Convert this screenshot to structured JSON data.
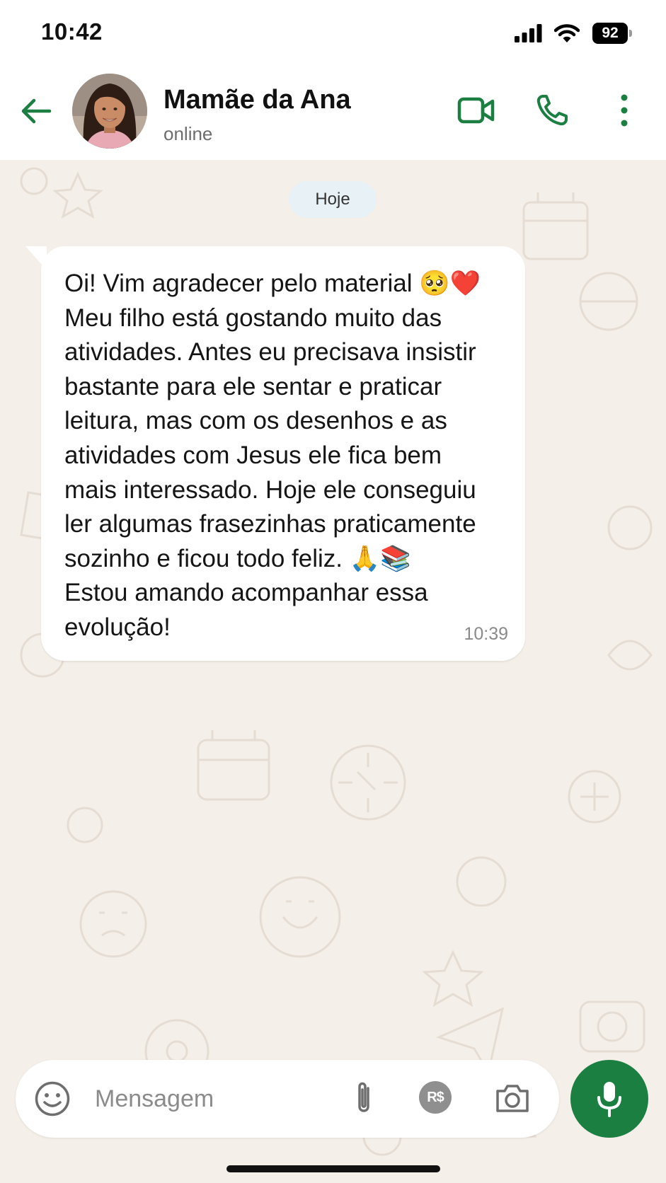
{
  "status_bar": {
    "time": "10:42",
    "battery": "92",
    "icons": [
      "signal-icon",
      "wifi-icon",
      "battery-icon"
    ]
  },
  "header": {
    "contact_name": "Mamãe da Ana",
    "contact_status": "online",
    "icons": [
      "back-arrow-icon",
      "video-camera-icon",
      "phone-icon",
      "more-vertical-icon"
    ]
  },
  "chat": {
    "date_chip": "Hoje",
    "messages": [
      {
        "direction": "incoming",
        "lines": [
          "Oi! Vim agradecer pelo material 🥺❤️",
          "Meu filho está gostando muito das",
          "atividades. Antes eu precisava insistir",
          "bastante para ele sentar e praticar",
          "leitura, mas com os desenhos e as",
          "atividades com Jesus ele fica bem",
          "mais interessado. Hoje ele conseguiu",
          "ler algumas frasezinhas praticamente",
          "sozinho e ficou todo feliz. 🙏📚",
          "Estou amando acompanhar essa",
          "evolução!"
        ],
        "time": "10:39"
      }
    ]
  },
  "composer": {
    "placeholder": "Mensagem",
    "value": "",
    "payment_label": "R$",
    "icons": [
      "emoji-icon",
      "paperclip-icon",
      "payment-icon",
      "camera-icon",
      "microphone-icon"
    ]
  },
  "colors": {
    "accent": "#1b7f42",
    "chat_background": "#f4efe8",
    "bubble": "#ffffff",
    "date_chip": "#e8f1f6"
  }
}
